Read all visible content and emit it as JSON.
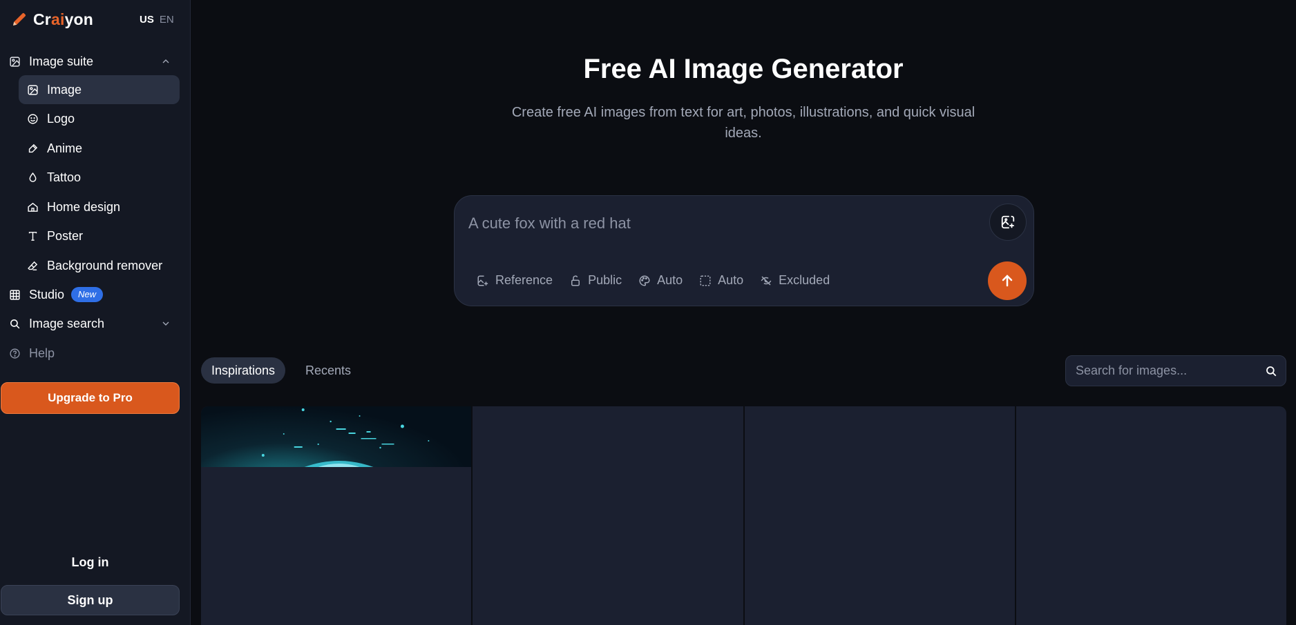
{
  "brand": {
    "name_pre": "Cr",
    "name_accent": "ai",
    "name_post": "yon"
  },
  "lang": {
    "region": "US",
    "language": "EN"
  },
  "sidebar": {
    "image_suite": "Image suite",
    "sub_items": [
      {
        "label": "Image",
        "icon": "image-icon",
        "active": true
      },
      {
        "label": "Logo",
        "icon": "smile-icon"
      },
      {
        "label": "Anime",
        "icon": "brush-icon"
      },
      {
        "label": "Tattoo",
        "icon": "drop-icon"
      },
      {
        "label": "Home design",
        "icon": "home-icon"
      },
      {
        "label": "Poster",
        "icon": "text-icon"
      },
      {
        "label": "Background remover",
        "icon": "eraser-icon"
      }
    ],
    "studio": "Studio",
    "studio_badge": "New",
    "image_search": "Image search",
    "help": "Help",
    "upgrade": "Upgrade to Pro",
    "login": "Log in",
    "signup": "Sign up"
  },
  "hero": {
    "title": "Free AI Image Generator",
    "subtitle": "Create free AI images from text for art, photos, illustrations, and quick visual ideas."
  },
  "prompt": {
    "placeholder": "A cute fox with a red hat",
    "options": [
      {
        "label": "Reference",
        "icon": "image-add-icon"
      },
      {
        "label": "Public",
        "icon": "lock-open-icon"
      },
      {
        "label": "Auto",
        "icon": "palette-icon"
      },
      {
        "label": "Auto",
        "icon": "aspect-ratio-icon"
      },
      {
        "label": "Excluded",
        "icon": "eye-off-icon"
      }
    ]
  },
  "tabs": {
    "inspirations": "Inspirations",
    "recents": "Recents"
  },
  "search": {
    "placeholder": "Search for images..."
  },
  "colors": {
    "accent": "#d9581d",
    "sidebar_bg": "#141823",
    "page_bg": "#0b0d12",
    "badge": "#2f6fe6"
  }
}
